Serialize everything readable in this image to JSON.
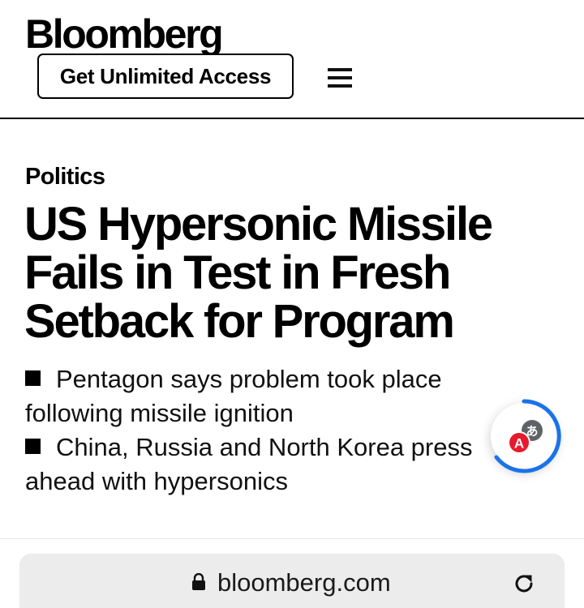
{
  "header": {
    "logo_text": "Bloomberg",
    "access_button_label": "Get Unlimited Access",
    "menu_icon": "hamburger-menu-icon"
  },
  "article": {
    "section": "Politics",
    "headline": "US Hypersonic Missile Fails in Test in Fresh Setback for Program",
    "bullets": [
      "Pentagon says problem took place following missile ignition",
      "China, Russia and North Korea press ahead with hypersonics"
    ]
  },
  "overlay": {
    "translate_fab_icon": "translate-icon",
    "translate_glyph_a": "A",
    "translate_glyph_b": "あ",
    "accent_color": "#1a73e8",
    "badge_color": "#e8192c"
  },
  "browser": {
    "url": "bloomberg.com",
    "lock_icon": "lock-icon",
    "reload_icon": "reload-icon"
  }
}
